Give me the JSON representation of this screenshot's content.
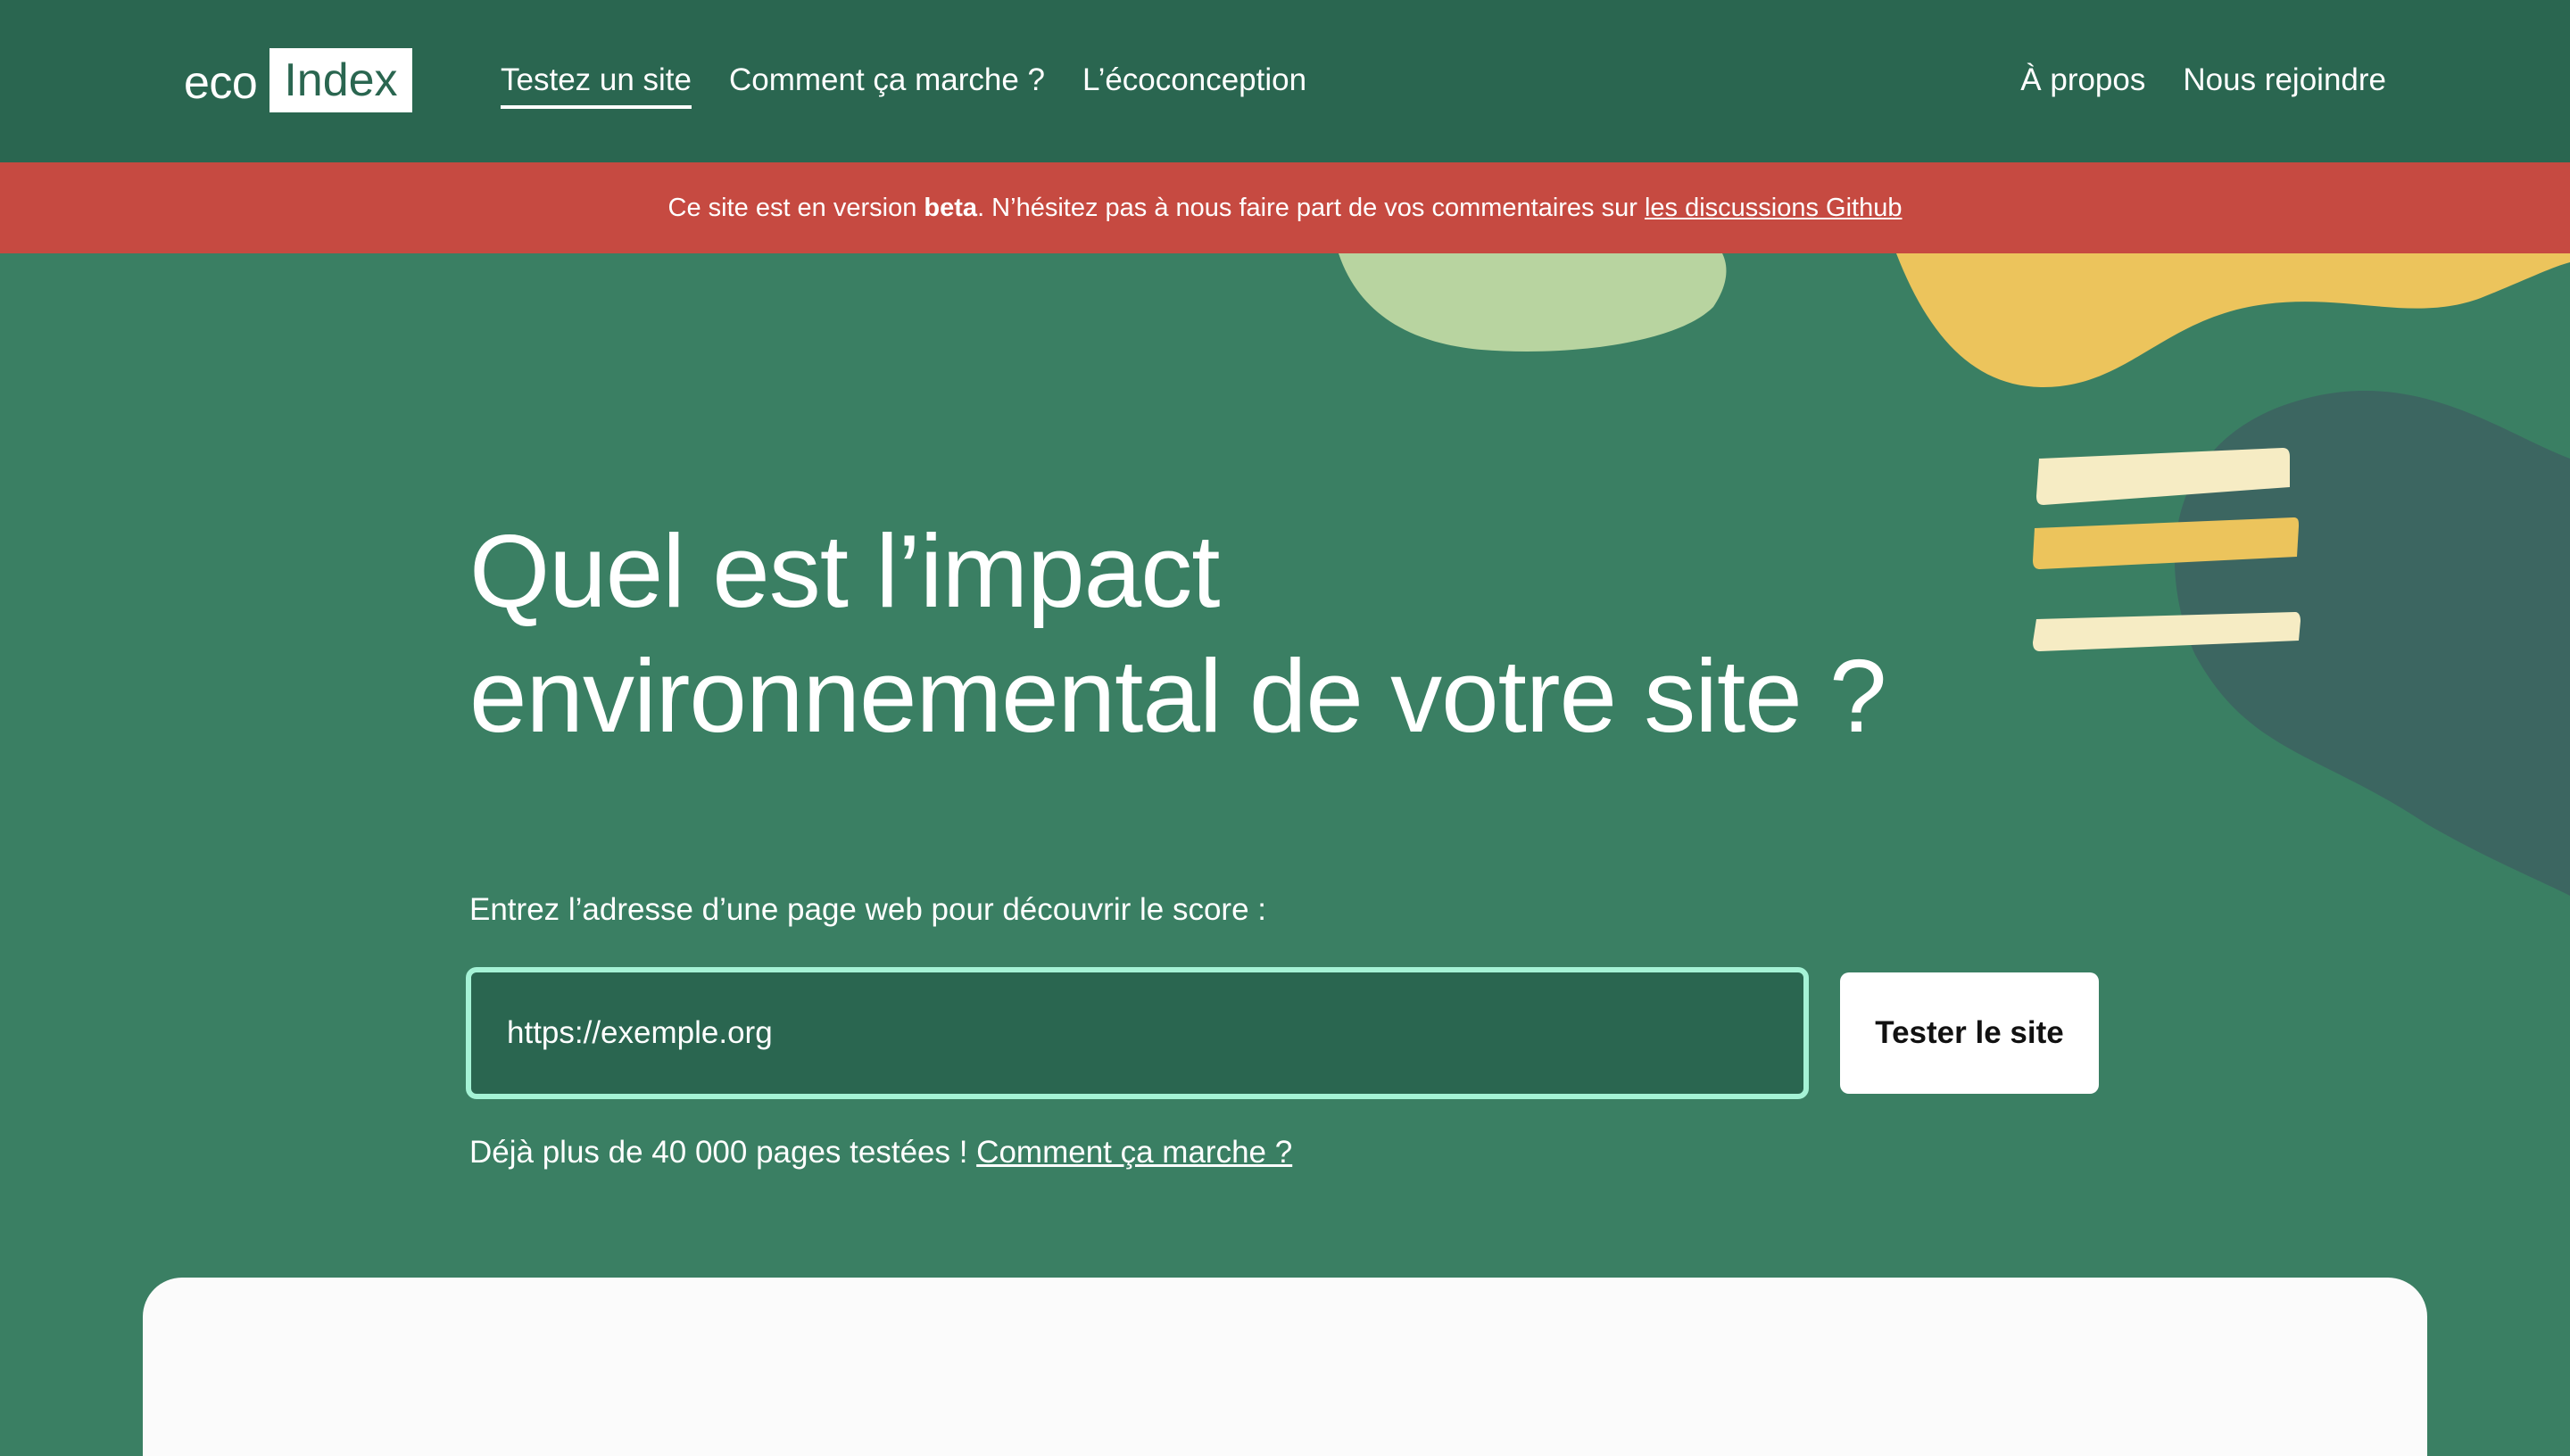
{
  "header": {
    "logo": {
      "eco": "eco",
      "index": "Index"
    },
    "nav_left": [
      {
        "label": "Testez un site",
        "active": true
      },
      {
        "label": "Comment ça marche ?",
        "active": false
      },
      {
        "label": "L’écoconception",
        "active": false
      }
    ],
    "nav_right": [
      {
        "label": "À propos"
      },
      {
        "label": "Nous rejoindre"
      }
    ]
  },
  "banner": {
    "text_before": "Ce site est en version ",
    "bold": "beta",
    "text_after": ". N’hésitez pas à nous faire part de vos commentaires sur ",
    "link": "les discussions Github"
  },
  "hero": {
    "title_line1": "Quel est l’impact",
    "title_line2": "environnemental de votre site ?",
    "input_label": "Entrez l’adresse d’une page web pour découvrir le score :",
    "input_value": "https://exemple.org",
    "submit_label": "Tester le site",
    "stats_text": "Déjà plus de 40 000 pages testées ! ",
    "stats_link": "Comment ça marche ?"
  },
  "colors": {
    "header_bg": "#2a6650",
    "hero_bg": "#3a7f63",
    "banner_bg": "#c64a41",
    "input_border": "#a5f3d6",
    "blob_light_green": "#b8d4a0",
    "blob_yellow": "#ecc45c",
    "blob_dark": "#3c6661",
    "stripe_cream": "#f6ecc4"
  }
}
